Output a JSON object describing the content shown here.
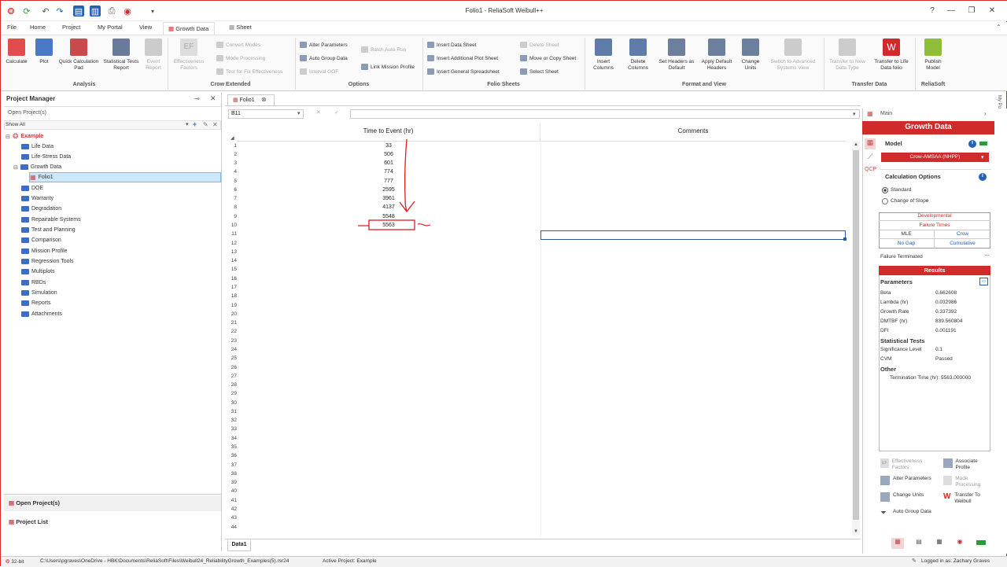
{
  "app": {
    "title": "Folio1 - ReliaSoft Weibull++"
  },
  "menu": [
    "File",
    "Home",
    "Project",
    "My Portal",
    "View",
    "Growth Data",
    "Sheet"
  ],
  "ribbon": {
    "calculate": "Calculate",
    "plot": "Plot",
    "quick_calc_pad": "Quick Calculation Pad",
    "stat_tests": "Statistical Tests Report",
    "event_report": "Event Report",
    "effectiveness_factors": "Effectiveness Factors",
    "convert_modes": "Convert Modes",
    "mode_processing": "Mode Processing",
    "test_for_fix": "Test for Fix Effectiveness",
    "alter_parameters": "Alter Parameters",
    "auto_group_data": "Auto Group Data",
    "interval_gof": "Interval GOF",
    "batch_auto_run": "Batch Auto Run",
    "link_mission_profile": "Link Mission Profile",
    "insert_data_sheet": "Insert Data Sheet",
    "insert_additional_plot": "Insert Additional Plot Sheet",
    "insert_general_spreadsheet": "Insert General Spreadsheet",
    "delete_sheet": "Delete Sheet",
    "move_copy_sheet": "Move or Copy Sheet",
    "select_sheet": "Select Sheet",
    "insert_columns": "Insert Columns",
    "delete_columns": "Delete Columns",
    "set_headers_default": "Set Headers as Default",
    "apply_default_headers": "Apply Default Headers",
    "change_units": "Change Units",
    "switch_advanced": "Switch to Advanced Systems View",
    "transfer_new_type": "Transfer to New Data Type",
    "transfer_life_folio": "Transfer to Life Data folio",
    "publish_model": "Publish Model",
    "groups": {
      "analysis": "Analysis",
      "crow_extended": "Crow Extended",
      "options": "Options",
      "folio_sheets": "Folio Sheets",
      "format_view": "Format and View",
      "transfer_data": "Transfer Data",
      "reliasoft": "ReliaSoft"
    }
  },
  "project_manager": {
    "title": "Project Manager",
    "open_projects": "Open Project(s)",
    "show_all": "Show All",
    "root": "Example",
    "items": [
      "Life Data",
      "Life-Stress Data",
      "Growth Data",
      "Folio1",
      "DOE",
      "Warranty",
      "Degradation",
      "Repairable Systems",
      "Test and Planning",
      "Comparison",
      "Mission Profile",
      "Regression Tools",
      "Multiplots",
      "RBDs",
      "Simulation",
      "Reports",
      "Attachments"
    ],
    "bottom_open": "Open Project(s)",
    "bottom_list": "Project List"
  },
  "sheet": {
    "tab": "Folio1",
    "cell_ref": "B11",
    "col_a": "Time to Event (hr)",
    "col_b": "Comments",
    "values": [
      "33",
      "506",
      "601",
      "774",
      "777",
      "2595",
      "3961",
      "4137",
      "5548",
      "5563"
    ],
    "sheet_tab": "Data1",
    "row_count": 44
  },
  "right_panel": {
    "main_label": "Main",
    "title": "Growth Data",
    "model_label": "Model",
    "model_value": "Crow-AMSAA (NHPP)",
    "calc_options": "Calculation Options",
    "opt_standard": "Standard",
    "opt_change_slope": "Change of Slope",
    "developmental": "Developmental",
    "failure_times": "Failure Times",
    "mle": "MLE",
    "crow": "Crow",
    "no_gap": "No Gap",
    "cumulative": "Cumulative",
    "failure_terminated": "Failure Terminated",
    "results": "Results",
    "parameters": "Parameters",
    "params": [
      {
        "k": "Beta",
        "v": "0.662608"
      },
      {
        "k": "Lambda (hr)",
        "v": "0.032986"
      },
      {
        "k": "Growth Rate",
        "v": "0.337392"
      },
      {
        "k": "DMTBF (hr)",
        "v": "839.560804"
      },
      {
        "k": "DFI",
        "v": "0.001191"
      }
    ],
    "stat_tests": "Statistical Tests",
    "tests": [
      {
        "k": "Significance Level",
        "v": "0.1"
      },
      {
        "k": "CVM",
        "v": "Passed"
      }
    ],
    "other": "Other",
    "termination": "Termination Time (hr): 5563.000000",
    "actions": [
      "Effectiveness Factors",
      "Associate Profile",
      "Alter Parameters",
      "Mode Processing",
      "Change Units",
      "Transfer To Weibull",
      "Auto Group Data"
    ]
  },
  "status": {
    "bits": "32-bit",
    "path": "C:\\Users\\pgraves\\OneDrive - HBK\\Documents\\ReliaSoft\\Files\\Weibull24_ReliabilityGrowth_Examples(5).rsr24",
    "active": "Active Project: Example",
    "logged": "Logged in as: Zachary Graves"
  },
  "colors": {
    "accent": "#d12a2a",
    "tree_sel": "#cfe7fb",
    "qa_active": "#2561b6"
  }
}
